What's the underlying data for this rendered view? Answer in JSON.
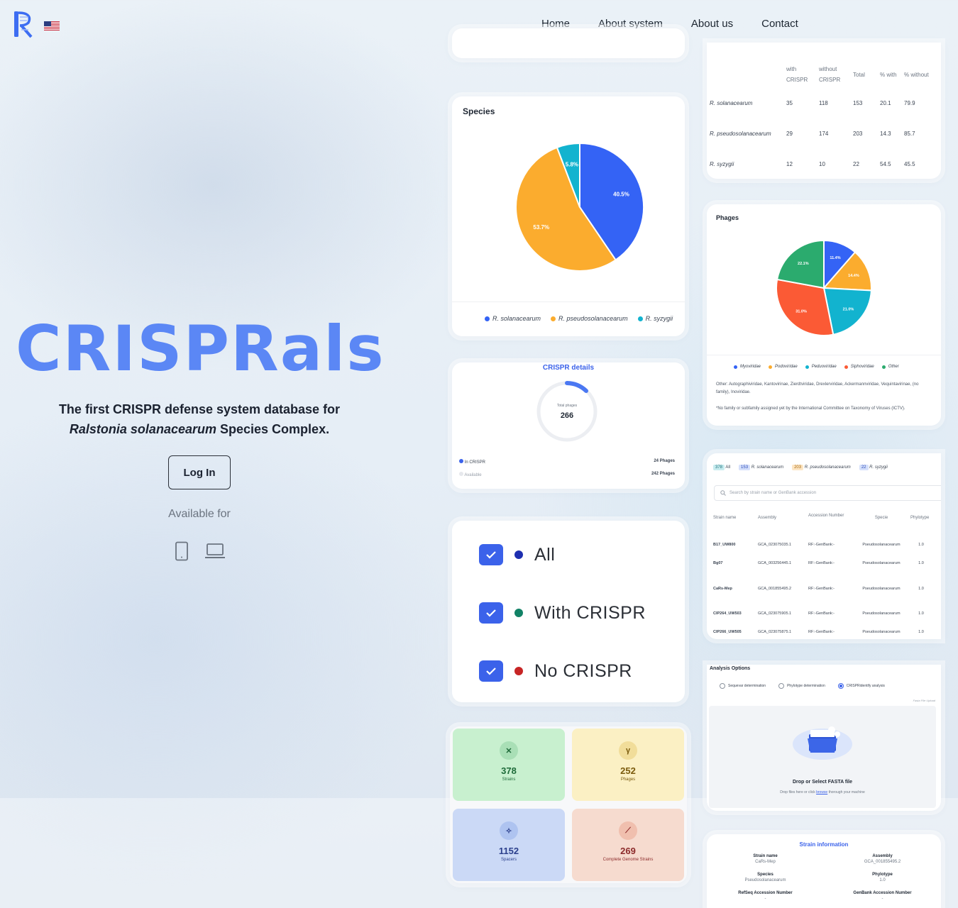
{
  "nav": {
    "links": [
      "Home",
      "About system",
      "About us",
      "Contact"
    ]
  },
  "hero": {
    "title": "CRISPRals",
    "subtitle_line1": "The first CRISPR defense system database for",
    "subtitle_italic": "Ralstonia solanacearum",
    "subtitle_end": "Species Complex.",
    "login_label": "Log In",
    "available_for": "Available for"
  },
  "species_card": {
    "title": "Species",
    "slices": [
      {
        "label": "R. solanacearum",
        "value": 40.5,
        "color": "#3463f5"
      },
      {
        "label": "R. pseudosolanacearum",
        "value": 53.7,
        "color": "#fbac2e"
      },
      {
        "label": "R. syzygii",
        "value": 5.8,
        "color": "#12b3cf"
      }
    ],
    "pct_labels": [
      "40.5%",
      "53.7%",
      "5.8%"
    ]
  },
  "crispr_details": {
    "title": "CRISPR details",
    "center_small": "Total phages",
    "center_value": "266",
    "rows": [
      {
        "label": "In CRISPR",
        "value": "24 Phages"
      },
      {
        "label": "Available",
        "value": "242 Phages"
      }
    ]
  },
  "filter_card": {
    "items": [
      {
        "label": "All",
        "dot": "#1e2fb0"
      },
      {
        "label": "With CRISPR",
        "dot": "#128266"
      },
      {
        "label": "No CRISPR",
        "dot": "#c72525"
      }
    ]
  },
  "stats": [
    {
      "value": "378",
      "label": "Strains",
      "bg": "#c8f0cf",
      "icon_bg": "#a9dfb6",
      "color": "#1f6b3a"
    },
    {
      "value": "252",
      "label": "Phages",
      "bg": "#fbf0c4",
      "icon_bg": "#f1dd9a",
      "color": "#7a5a0c"
    },
    {
      "value": "1152",
      "label": "Spacers",
      "bg": "#cbd9f6",
      "icon_bg": "#aec3f0",
      "color": "#2b3f8c"
    },
    {
      "value": "269",
      "label": "Complete Genome Strains",
      "bg": "#f6dbcf",
      "icon_bg": "#f0bfae",
      "color": "#8c2b2b"
    }
  ],
  "species_table": {
    "headers": [
      "",
      "with CRISPR",
      "without CRISPR",
      "Total",
      "% with",
      "% without"
    ],
    "rows": [
      [
        "R. solanacearum",
        "35",
        "118",
        "153",
        "20.1",
        "79.9"
      ],
      [
        "R. pseudosolanacearum",
        "29",
        "174",
        "203",
        "14.3",
        "85.7"
      ],
      [
        "R. syzygii",
        "12",
        "10",
        "22",
        "54.5",
        "45.5"
      ]
    ]
  },
  "phages_card": {
    "title": "Phages",
    "slices": [
      {
        "label": "Myoviridae",
        "value": 11.4,
        "color": "#3463f5"
      },
      {
        "label": "Podoviridae",
        "value": 14.4,
        "color": "#fbac2e"
      },
      {
        "label": "Peduoviridae",
        "value": 21.0,
        "color": "#12b3cf"
      },
      {
        "label": "Siphoviridae",
        "value": 31.0,
        "color": "#fb5a35"
      },
      {
        "label": "Other",
        "value": 22.1,
        "color": "#2bab6e"
      }
    ],
    "pct_labels": [
      "11.4%",
      "14.4%",
      "21.0%",
      "31.0%",
      "22.1%"
    ],
    "note1": "Other: Autographiviridae, Kantovirinae, Zierdtviridae, Drexlerviridae, Ackermannviridae, Vequintavirinae, (no family), Inoviridae.",
    "note2": "*No family or subfamily assigned yet by the International Committee on Taxonomy of Viruses (ICTV)."
  },
  "strain_list": {
    "tabs": [
      {
        "count": "378",
        "label": "All",
        "bg": "#c8ecef",
        "color": "#1b6f7a"
      },
      {
        "count": "153",
        "label": "R. solanacearum",
        "bg": "#d5e0fb",
        "color": "#2b4ab8"
      },
      {
        "count": "203",
        "label": "R. pseudosolanacearum",
        "bg": "#fde6c5",
        "color": "#a86a10"
      },
      {
        "count": "22",
        "label": "R. syzygii",
        "bg": "#d5e0fb",
        "color": "#2b4ab8"
      }
    ],
    "search_placeholder": "Search by strain name or GenBank accession",
    "headers": [
      "Strain name",
      "Assembly",
      "Accession Number",
      "Specie",
      "Phylotype"
    ],
    "rows": [
      [
        "B17_UW800",
        "GCA_023075035.1",
        "RF:-GenBank:-",
        "Pseudosolanacearum",
        "1.0"
      ],
      [
        "Bg07",
        "GCA_003256445.1",
        "RF:-GenBank:-",
        "Pseudosolanacearum",
        "1.0"
      ],
      [
        "CaRs-Mep",
        "GCA_001855495.2",
        "RF:-GenBank:-",
        "Pseudosolanacearum",
        "1.0"
      ],
      [
        "CIP264_UW503",
        "GCA_023075905.1",
        "RF:-GenBank:-",
        "Pseudosolanacearum",
        "1.0"
      ],
      [
        "CIP266_UW505",
        "GCA_023075875.1",
        "RF:-GenBank:-",
        "Pseudosolanacearum",
        "1.0"
      ]
    ]
  },
  "analysis_card": {
    "title": "Analysis Options",
    "options": [
      "Sequevar determination",
      "Phylotype determination",
      "CRISPRidentify analysis"
    ],
    "upload_hint": "Fasta File Upload",
    "drop_title": "Drop or Select FASTA file",
    "drop_sub_a": "Drop files here or click",
    "drop_sub_link": "browse",
    "drop_sub_b": "thorough your machine"
  },
  "strain_info": {
    "title": "Strain information",
    "fields": [
      {
        "label": "Strain name",
        "value": "CaRs-Mep"
      },
      {
        "label": "Assembly",
        "value": "GCA_001855495.2"
      },
      {
        "label": "Species",
        "value": "Pseudosolanacearum"
      },
      {
        "label": "Phylotype",
        "value": "1.0"
      },
      {
        "label": "RefSeq Accession Number",
        "value": "-"
      },
      {
        "label": "GenBank Accession Number",
        "value": "-"
      }
    ]
  }
}
